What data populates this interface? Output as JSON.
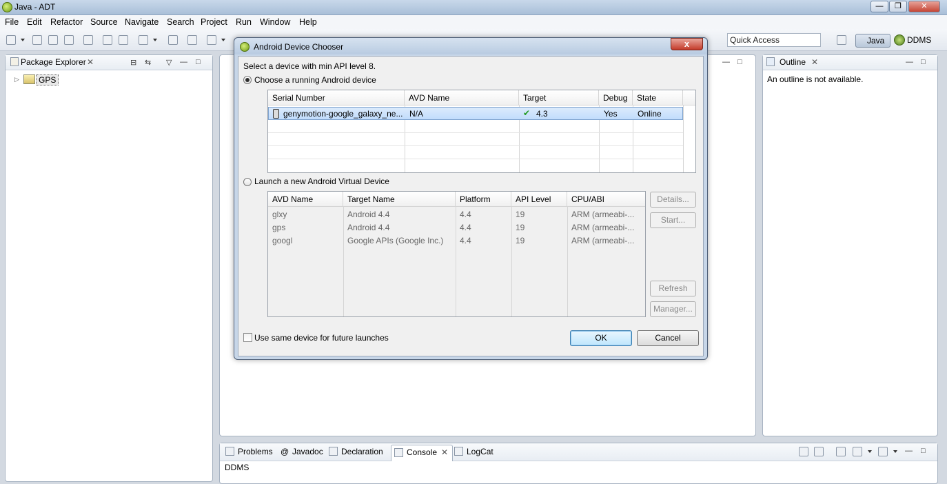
{
  "window": {
    "title": "Java - ADT"
  },
  "menu": [
    "File",
    "Edit",
    "Refactor",
    "Source",
    "Navigate",
    "Search",
    "Project",
    "Run",
    "Window",
    "Help"
  ],
  "toolbar": {
    "quick_access": "Quick Access"
  },
  "perspectives": {
    "java": "Java",
    "ddms": "DDMS"
  },
  "package_explorer": {
    "tab": "Package Explorer",
    "tree_item": "GPS"
  },
  "outline": {
    "tab": "Outline",
    "message": "An outline is not available."
  },
  "dialog": {
    "title": "Android Device Chooser",
    "close": "x",
    "prompt": "Select a device with min API level 8.",
    "option_running": "Choose a running Android device",
    "running_table": {
      "headers": [
        "Serial Number",
        "AVD Name",
        "Target",
        "Debug",
        "State"
      ],
      "rows": [
        [
          "genymotion-google_galaxy_ne...",
          "N/A",
          "4.3",
          "Yes",
          "Online"
        ]
      ]
    },
    "option_new": "Launch a new Android Virtual Device",
    "avd_table": {
      "headers": [
        "AVD Name",
        "Target Name",
        "Platform",
        "API Level",
        "CPU/ABI"
      ],
      "rows": [
        [
          "glxy",
          "Android 4.4",
          "4.4",
          "19",
          "ARM (armeabi-..."
        ],
        [
          "gps",
          "Android 4.4",
          "4.4",
          "19",
          "ARM (armeabi-..."
        ],
        [
          "googl",
          "Google APIs (Google Inc.)",
          "4.4",
          "19",
          "ARM (armeabi-..."
        ]
      ]
    },
    "buttons": {
      "details": "Details...",
      "start": "Start...",
      "refresh": "Refresh",
      "manager": "Manager...",
      "ok": "OK",
      "cancel": "Cancel"
    },
    "same_device": "Use same device for future launches"
  },
  "console": {
    "tabs": [
      "Problems",
      "Javadoc",
      "Declaration",
      "Console",
      "LogCat"
    ],
    "content": "DDMS"
  }
}
